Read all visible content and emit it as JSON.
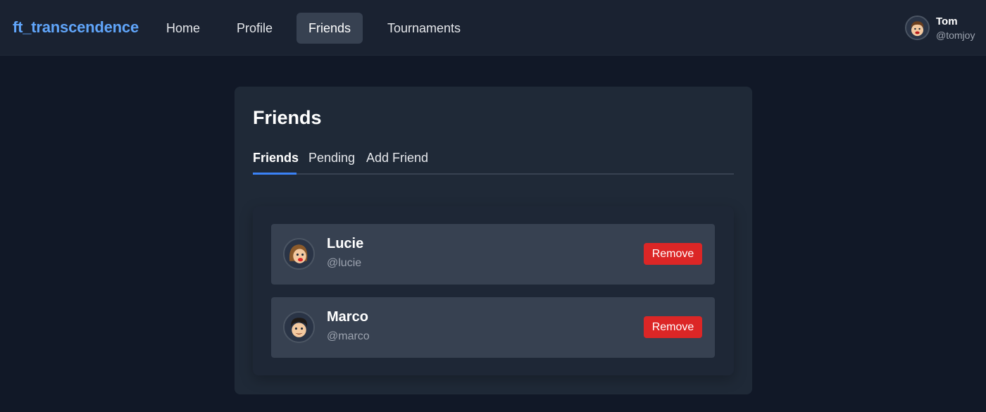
{
  "app": {
    "brand": "ft_transcendence"
  },
  "nav": {
    "items": [
      {
        "label": "Home",
        "active": false
      },
      {
        "label": "Profile",
        "active": false
      },
      {
        "label": "Friends",
        "active": true
      },
      {
        "label": "Tournaments",
        "active": false
      }
    ]
  },
  "user": {
    "name": "Tom",
    "handle": "@tomjoy",
    "avatar_icon": "cartoon-avatar-icon"
  },
  "page": {
    "title": "Friends",
    "tabs": [
      {
        "label": "Friends",
        "active": true
      },
      {
        "label": "Pending",
        "active": false
      },
      {
        "label": "Add Friend",
        "active": false
      }
    ]
  },
  "friends": [
    {
      "name": "Lucie",
      "handle": "@lucie",
      "action_label": "Remove",
      "avatar_icon": "cartoon-avatar-icon"
    },
    {
      "name": "Marco",
      "handle": "@marco",
      "action_label": "Remove",
      "avatar_icon": "cartoon-avatar-icon"
    }
  ],
  "colors": {
    "background": "#111827",
    "navbar": "#1a2231",
    "card": "#1f2937",
    "row": "#374151",
    "brand": "#60a5fa",
    "accent": "#3b82f6",
    "danger": "#dc2626",
    "muted_text": "#9ca3af"
  }
}
